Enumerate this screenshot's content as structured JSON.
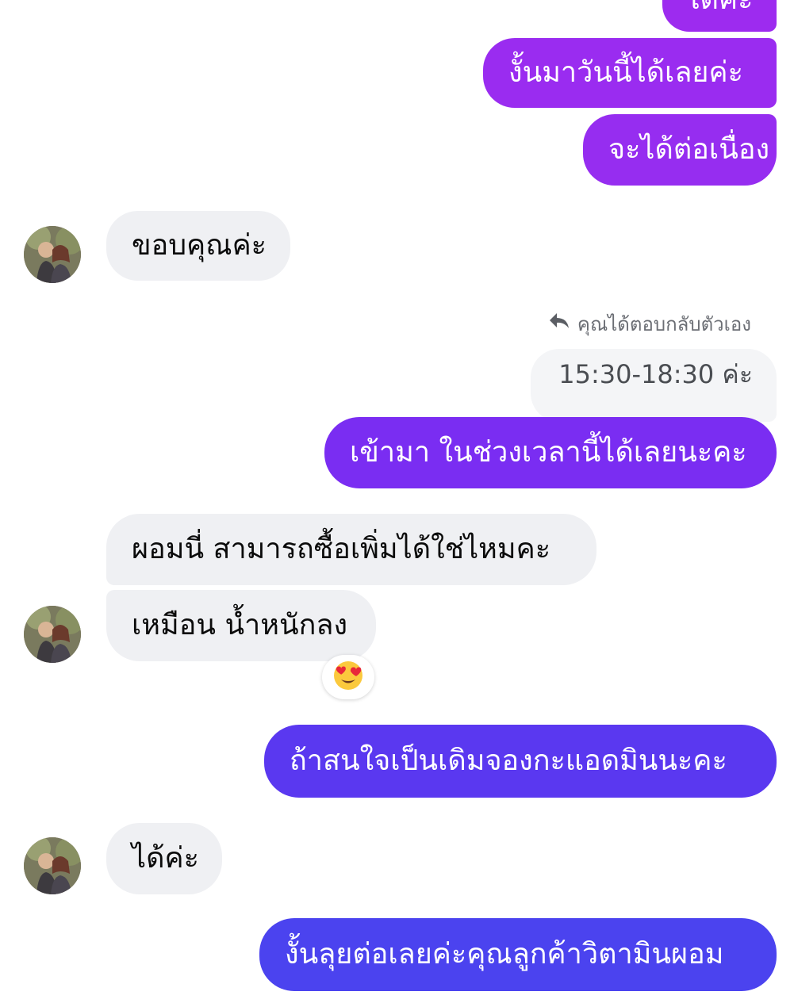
{
  "messages": {
    "m0": "ได้ค่ะ",
    "m1": "งั้นมาวันนี้ได้เลยค่ะ",
    "m2": "จะได้ต่อเนื่อง",
    "m3": "ขอบคุณค่ะ",
    "reply_note": "คุณได้ตอบกลับตัวเอง",
    "quoted": "15:30-18:30 ค่ะ",
    "m4": "เข้ามา ในช่วงเวลานี้ได้เลยนะคะ",
    "m5": "ผอมนี่ สามารถซื้อเพิ่มได้ใช่ไหมคะ",
    "m6": "เหมือน น้ำหนักลง",
    "m7": "ถ้าสนใจเป็นเดิมจองกะแอดมินนะคะ",
    "m8": "ได้ค่ะ",
    "m9": "งั้นลุยต่อเลยค่ะคุณลูกค้าวิตามินผอม"
  },
  "icons": {
    "reply": "reply-arrow-icon",
    "reaction": "heart-eyes-emoji-icon",
    "avatar": "contact-avatar"
  },
  "colors": {
    "outgoing_top": "#9b2cf0",
    "outgoing_mid": "#7b2cf2",
    "outgoing_bottom": "#4b43ef",
    "incoming": "#eff0f3"
  }
}
